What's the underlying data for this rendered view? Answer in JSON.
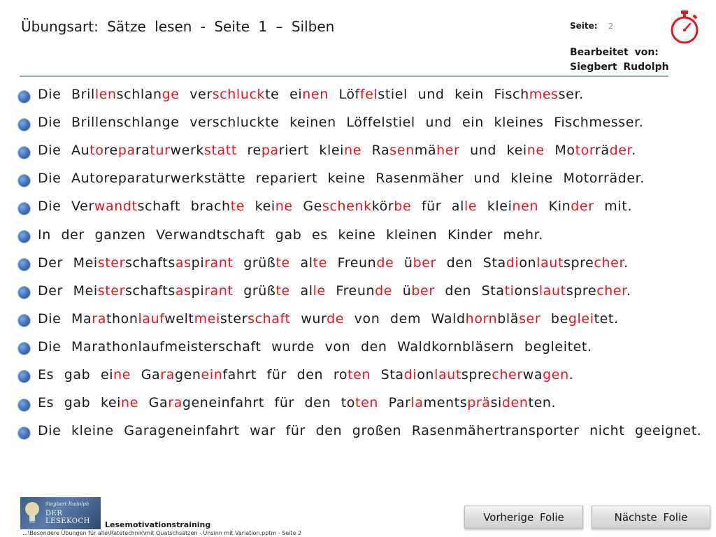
{
  "header": {
    "title": "Übungsart: Sätze lesen - Seite 1 – Silben",
    "page_label": "Seite:",
    "page_number": "2",
    "editor_label": "Bearbeitet von:",
    "editor_name": "Siegbert Rudolph"
  },
  "colors": {
    "accent_red": "#e8141b",
    "bullet_blue": "#3c6fb8",
    "rule_blue": "#8fa9cf"
  },
  "icons": {
    "timer": "stopwatch-icon",
    "bullet": "round-bullet-icon"
  },
  "sentences": [
    [
      [
        "Die Bril",
        0
      ],
      [
        "len",
        1
      ],
      [
        "schlan",
        0
      ],
      [
        "ge",
        1
      ],
      [
        " ver",
        0
      ],
      [
        "schluck",
        1
      ],
      [
        "te ei",
        0
      ],
      [
        "nen",
        1
      ],
      [
        " Löf",
        0
      ],
      [
        "fel",
        1
      ],
      [
        "stiel und kein Fisch",
        0
      ],
      [
        "mes",
        1
      ],
      [
        "ser.",
        0
      ]
    ],
    [
      [
        "Die Brillenschlange verschluckte keinen Löffelstiel und ein kleines Fischmesser.",
        0
      ]
    ],
    [
      [
        "Die Au",
        0
      ],
      [
        "to",
        1
      ],
      [
        "re",
        0
      ],
      [
        "pa",
        1
      ],
      [
        "ra",
        0
      ],
      [
        "tur",
        1
      ],
      [
        "werk",
        0
      ],
      [
        "statt",
        1
      ],
      [
        " re",
        0
      ],
      [
        "pa",
        1
      ],
      [
        "riert klei",
        0
      ],
      [
        "ne",
        1
      ],
      [
        " Ra",
        0
      ],
      [
        "sen",
        1
      ],
      [
        "mä",
        0
      ],
      [
        "her",
        1
      ],
      [
        " und kei",
        0
      ],
      [
        "ne",
        1
      ],
      [
        " Mo",
        0
      ],
      [
        "tor",
        1
      ],
      [
        "rä",
        0
      ],
      [
        "der",
        1
      ],
      [
        ".",
        0
      ]
    ],
    [
      [
        "Die Autoreparaturwerkstätte repariert keine Rasenmäher und kleine Motorräder.",
        0
      ]
    ],
    [
      [
        "Die Ver",
        0
      ],
      [
        "wandt",
        1
      ],
      [
        "schaft brach",
        0
      ],
      [
        "te",
        1
      ],
      [
        " kei",
        0
      ],
      [
        "ne",
        1
      ],
      [
        " Ge",
        0
      ],
      [
        "schenk",
        1
      ],
      [
        "kör",
        0
      ],
      [
        "be",
        1
      ],
      [
        " für al",
        0
      ],
      [
        "le",
        1
      ],
      [
        " klei",
        0
      ],
      [
        "nen",
        1
      ],
      [
        " Kin",
        0
      ],
      [
        "der",
        1
      ],
      [
        " mit.",
        0
      ]
    ],
    [
      [
        "In der ganzen Verwandtschaft gab es keine kleinen Kinder mehr.",
        0
      ]
    ],
    [
      [
        "Der Mei",
        0
      ],
      [
        "ster",
        1
      ],
      [
        "schafts",
        0
      ],
      [
        "as",
        1
      ],
      [
        "pi",
        0
      ],
      [
        "rant",
        1
      ],
      [
        " grüß",
        0
      ],
      [
        "te",
        1
      ],
      [
        " al",
        0
      ],
      [
        "te",
        1
      ],
      [
        " Freun",
        0
      ],
      [
        "de",
        1
      ],
      [
        " ü",
        0
      ],
      [
        "ber",
        1
      ],
      [
        " den Sta",
        0
      ],
      [
        "di",
        1
      ],
      [
        "on",
        0
      ],
      [
        "laut",
        1
      ],
      [
        "spre",
        0
      ],
      [
        "cher",
        1
      ],
      [
        ".",
        0
      ]
    ],
    [
      [
        "Der Mei",
        0
      ],
      [
        "ster",
        1
      ],
      [
        "schafts",
        0
      ],
      [
        "as",
        1
      ],
      [
        "pi",
        0
      ],
      [
        "rant",
        1
      ],
      [
        " grüß",
        0
      ],
      [
        "te",
        1
      ],
      [
        " al",
        0
      ],
      [
        "le",
        1
      ],
      [
        " Freun",
        0
      ],
      [
        "de",
        1
      ],
      [
        " ü",
        0
      ],
      [
        "ber",
        1
      ],
      [
        " den Sta",
        0
      ],
      [
        "ti",
        1
      ],
      [
        "ons",
        0
      ],
      [
        "laut",
        1
      ],
      [
        "spre",
        0
      ],
      [
        "cher",
        1
      ],
      [
        ".",
        0
      ]
    ],
    [
      [
        "Die Ma",
        0
      ],
      [
        "ra",
        1
      ],
      [
        "thon",
        0
      ],
      [
        "lauf",
        1
      ],
      [
        "welt",
        0
      ],
      [
        "mei",
        1
      ],
      [
        "ster",
        0
      ],
      [
        "schaft",
        1
      ],
      [
        " wur",
        0
      ],
      [
        "de",
        1
      ],
      [
        " von dem Wald",
        0
      ],
      [
        "horn",
        1
      ],
      [
        "blä",
        0
      ],
      [
        "ser",
        1
      ],
      [
        " be",
        0
      ],
      [
        "glei",
        1
      ],
      [
        "tet.",
        0
      ]
    ],
    [
      [
        "Die Marathonlaufmeisterschaft wurde von den Waldkornbläsern begleitet.",
        0
      ]
    ],
    [
      [
        "Es gab ei",
        0
      ],
      [
        "ne",
        1
      ],
      [
        " Ga",
        0
      ],
      [
        "ra",
        1
      ],
      [
        "gen",
        0
      ],
      [
        "ein",
        1
      ],
      [
        "fahrt für den ro",
        0
      ],
      [
        "ten",
        1
      ],
      [
        " Sta",
        0
      ],
      [
        "di",
        1
      ],
      [
        "on",
        0
      ],
      [
        "laut",
        1
      ],
      [
        "spre",
        0
      ],
      [
        "cher",
        1
      ],
      [
        "wa",
        0
      ],
      [
        "gen",
        1
      ],
      [
        ".",
        0
      ]
    ],
    [
      [
        "Es gab kei",
        0
      ],
      [
        "ne",
        1
      ],
      [
        " Ga",
        0
      ],
      [
        "ra",
        1
      ],
      [
        "geneinfahrt für den to",
        0
      ],
      [
        "ten",
        1
      ],
      [
        " Par",
        0
      ],
      [
        "la",
        1
      ],
      [
        "ments",
        0
      ],
      [
        "prä",
        1
      ],
      [
        "si",
        0
      ],
      [
        "den",
        1
      ],
      [
        "ten.",
        0
      ]
    ],
    [
      [
        "Die kleine Garageneinfahrt war für den großen Rasenmähertransporter nicht geeignet.",
        0
      ]
    ]
  ],
  "logo": {
    "name": "Siegbert Rudolph",
    "brand": "DER LESEKOCH"
  },
  "footer": {
    "title": "Lesemotivationstraining",
    "path": "...\\Besondere Übungen für alle\\Ratetechnik\\mit Quatschsätzen - Unsinn mit Variation.pptm - Seite 2"
  },
  "nav": {
    "prev_label": "Vorherige Folie",
    "next_label": "Nächste Folie"
  }
}
